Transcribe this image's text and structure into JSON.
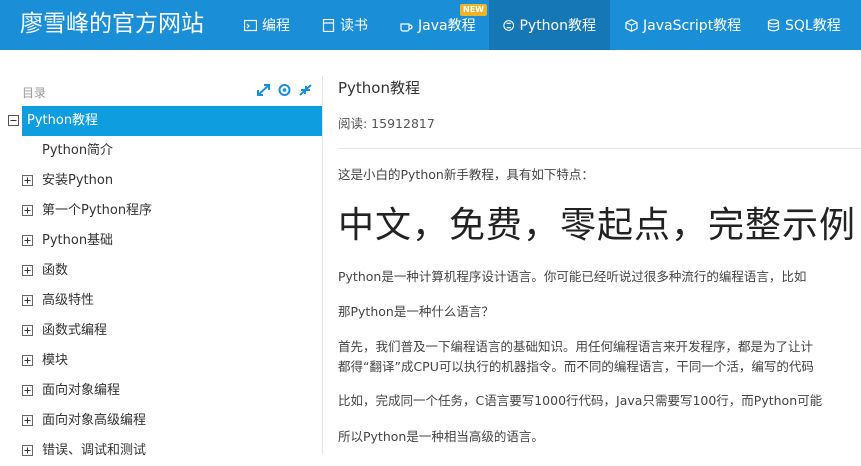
{
  "site": {
    "brand": "廖雪峰的官方网站"
  },
  "nav": {
    "items": [
      {
        "label": "编程",
        "icon": "code-icon"
      },
      {
        "label": "读书",
        "icon": "book-icon"
      },
      {
        "label": "Java教程",
        "icon": "coffee-cup-icon",
        "badge": "NEW"
      },
      {
        "label": "Python教程",
        "icon": "python-icon",
        "active": true
      },
      {
        "label": "JavaScript教程",
        "icon": "cube-icon"
      },
      {
        "label": "SQL教程",
        "icon": "database-icon"
      }
    ]
  },
  "sidebar": {
    "title": "目录",
    "tools": [
      "expand-icon",
      "locate-icon",
      "collapse-icon"
    ],
    "items": [
      {
        "label": "Python教程",
        "active": true,
        "toggle": "minus"
      },
      {
        "label": "Python简介",
        "toggle": "none"
      },
      {
        "label": "安装Python",
        "toggle": "plus"
      },
      {
        "label": "第一个Python程序",
        "toggle": "plus"
      },
      {
        "label": "Python基础",
        "toggle": "plus"
      },
      {
        "label": "函数",
        "toggle": "plus"
      },
      {
        "label": "高级特性",
        "toggle": "plus"
      },
      {
        "label": "函数式编程",
        "toggle": "plus"
      },
      {
        "label": "模块",
        "toggle": "plus"
      },
      {
        "label": "面向对象编程",
        "toggle": "plus"
      },
      {
        "label": "面向对象高级编程",
        "toggle": "plus"
      },
      {
        "label": "错误、调试和测试",
        "toggle": "plus"
      }
    ]
  },
  "main": {
    "title": "Python教程",
    "read_label": "阅读: 15912817",
    "intro": "这是小白的Python新手教程，具有如下特点：",
    "headline": "中文，免费，零起点，完整示例，",
    "paragraphs": [
      "Python是一种计算机程序设计语言。你可能已经听说过很多种流行的编程语言，比如",
      "那Python是一种什么语言？",
      "首先，我们普及一下编程语言的基础知识。用任何编程语言来开发程序，都是为了让计",
      "都得“翻译”成CPU可以执行的机器指令。而不同的编程语言，干同一个活，编写的代码",
      "比如，完成同一个任务，C语言要写1000行代码，Java只需要写100行，而Python可能",
      "所以Python是一种相当高级的语言。"
    ]
  },
  "colors": {
    "topbar": "#1a8fd7",
    "topbar_active": "#1577b5",
    "toc_active": "#0e9ee0",
    "new_badge": "#f0b323"
  }
}
